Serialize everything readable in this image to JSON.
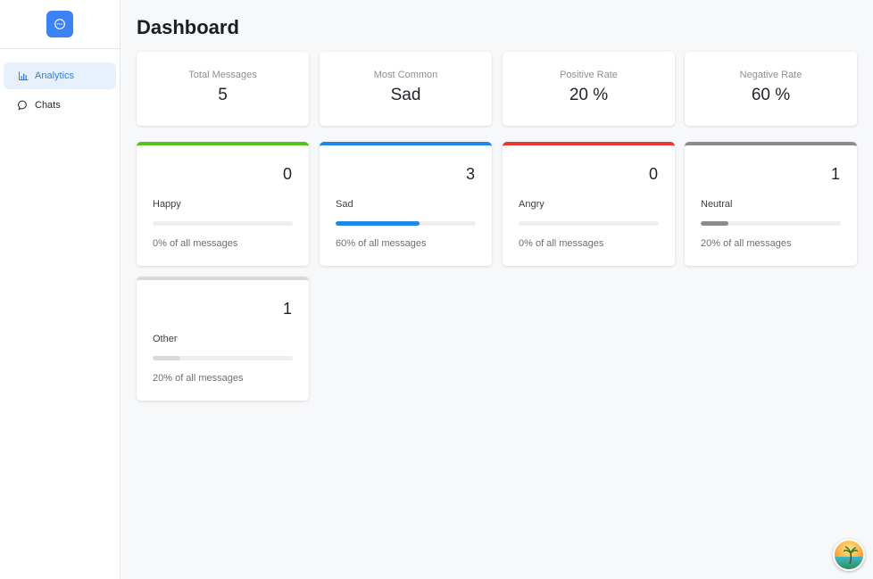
{
  "sidebar": {
    "items": [
      {
        "label": "Analytics",
        "icon": "bar-chart-icon",
        "active": true
      },
      {
        "label": "Chats",
        "icon": "chat-bubble-icon",
        "active": false
      }
    ]
  },
  "page_title": "Dashboard",
  "stats": [
    {
      "label": "Total Messages",
      "value": "5"
    },
    {
      "label": "Most Common",
      "value": "Sad"
    },
    {
      "label": "Positive Rate",
      "value": "20 %"
    },
    {
      "label": "Negative Rate",
      "value": "60 %"
    }
  ],
  "emotions": [
    {
      "label": "Happy",
      "count": "0",
      "percent_text": "0% of all messages",
      "fraction": 0.0,
      "color": "#52c41a"
    },
    {
      "label": "Sad",
      "count": "3",
      "percent_text": "60% of all messages",
      "fraction": 0.6,
      "color": "#1e88e5"
    },
    {
      "label": "Angry",
      "count": "0",
      "percent_text": "0% of all messages",
      "fraction": 0.0,
      "color": "#e53935"
    },
    {
      "label": "Neutral",
      "count": "1",
      "percent_text": "20% of all messages",
      "fraction": 0.2,
      "color": "#8c8c8c"
    },
    {
      "label": "Other",
      "count": "1",
      "percent_text": "20% of all messages",
      "fraction": 0.2,
      "color": "#d9d9d9"
    }
  ],
  "colors": {
    "accent": "#3b82f6",
    "active_nav_bg": "#e6f1fc",
    "active_nav_text": "#2f7ee6"
  }
}
